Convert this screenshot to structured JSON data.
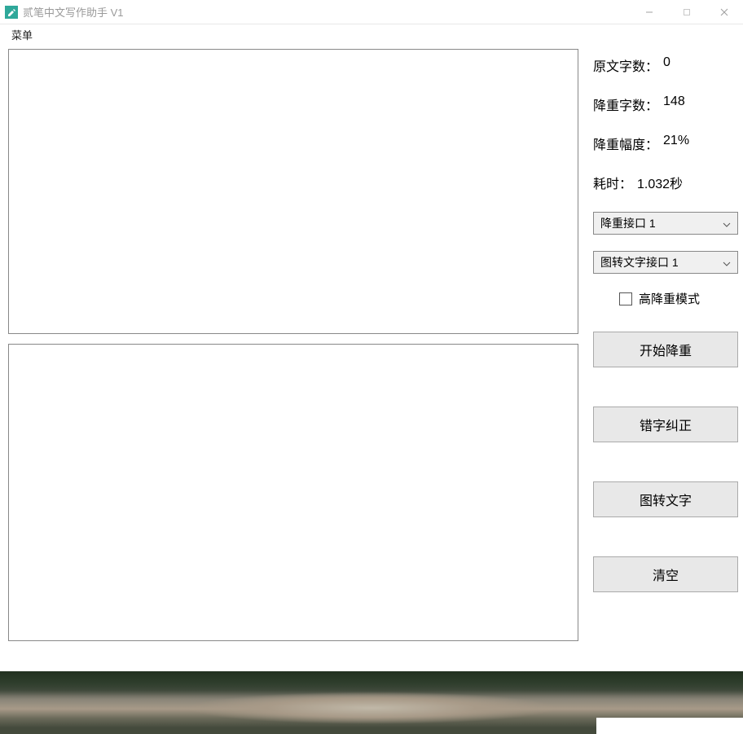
{
  "titlebar": {
    "title": "贰笔中文写作助手 V1"
  },
  "menubar": {
    "menu_label": "菜单"
  },
  "stats": {
    "original_label": "原文字数：",
    "original_value": "0",
    "reduced_label": "降重字数：",
    "reduced_value": "148",
    "ratio_label": "降重幅度：",
    "ratio_value": "21%",
    "time_label": "耗时：",
    "time_value": "1.032秒"
  },
  "selects": {
    "interface1": "降重接口 1",
    "interface2": "图转文字接口 1"
  },
  "checkbox": {
    "label": "高降重模式"
  },
  "buttons": {
    "start": "开始降重",
    "correct": "错字纠正",
    "img2text": "图转文字",
    "clear": "清空"
  },
  "textareas": {
    "input_text": "",
    "output_text": ""
  }
}
